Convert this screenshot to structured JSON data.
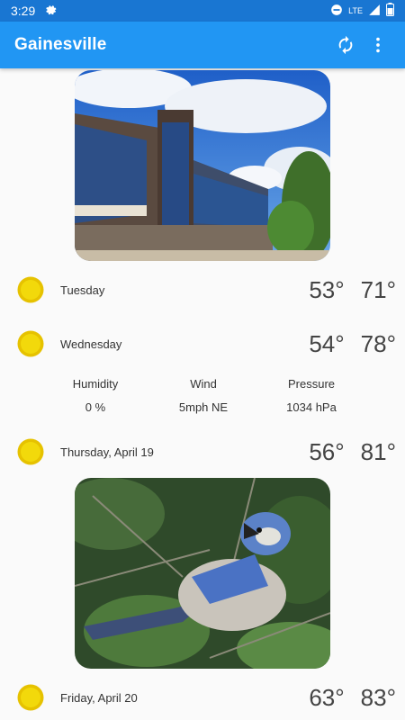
{
  "status": {
    "time": "3:29",
    "network": "LTE"
  },
  "appbar": {
    "title": "Gainesville"
  },
  "forecast": [
    {
      "day": "Tuesday",
      "low": "53°",
      "high": "71°",
      "icon": "sun-icon"
    },
    {
      "day": "Wednesday",
      "low": "54°",
      "high": "78°",
      "icon": "sun-icon"
    },
    {
      "day": "Thursday, April 19",
      "low": "56°",
      "high": "81°",
      "icon": "sun-icon"
    },
    {
      "day": "Friday, April 20",
      "low": "63°",
      "high": "83°",
      "icon": "sun-icon"
    }
  ],
  "details": {
    "humidity_label": "Humidity",
    "humidity_value": "0 %",
    "wind_label": "Wind",
    "wind_value": "5mph NE",
    "pressure_label": "Pressure",
    "pressure_value": "1034 hPa"
  },
  "colors": {
    "status_bar": "#1976d2",
    "app_bar": "#2196f3",
    "sun": "#f2d90b"
  }
}
